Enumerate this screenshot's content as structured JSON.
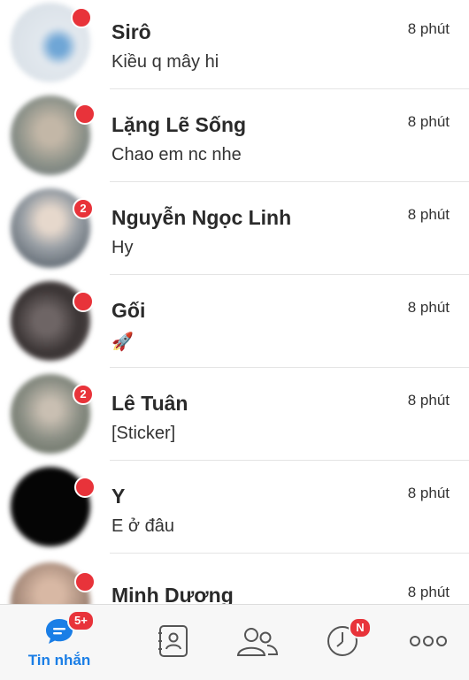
{
  "conversations": [
    {
      "name": "Sirô",
      "message": "Kiều q mây hi",
      "time": "8 phút",
      "avatar_color": "#dde4ea",
      "badge": ""
    },
    {
      "name": "Lặng Lẽ Sống",
      "message": "Chao em nc nhe",
      "time": "8 phút",
      "avatar_color": "#a8a89a",
      "badge": ""
    },
    {
      "name": "Nguyễn Ngọc Linh",
      "message": "Hy",
      "time": "8 phút",
      "avatar_color": "#8f949a",
      "badge": "2"
    },
    {
      "name": "Gối",
      "message": "🚀",
      "time": "8 phút",
      "avatar_color": "#4a4444",
      "badge": ""
    },
    {
      "name": "Lê Tuân",
      "message": "[Sticker]",
      "time": "8 phút",
      "avatar_color": "#8c8e86",
      "badge": "2"
    },
    {
      "name": "Y",
      "message": "E ở đâu",
      "time": "8 phút",
      "avatar_color": "#050505",
      "badge": ""
    },
    {
      "name": "Minh Dương",
      "message": "",
      "time": "8 phút",
      "avatar_color": "#b09686",
      "badge": ""
    }
  ],
  "tabbar": {
    "messages": {
      "label": "Tin nhắn",
      "badge": "5+",
      "icon": "chat-bubble-icon"
    },
    "contacts": {
      "icon": "contact-book-icon"
    },
    "groups": {
      "icon": "group-icon"
    },
    "timeline": {
      "icon": "clock-icon",
      "badge": "N"
    },
    "more": {
      "icon": "more-icon"
    }
  },
  "colors": {
    "accent": "#1a7ee6",
    "badge": "#e8333a"
  }
}
